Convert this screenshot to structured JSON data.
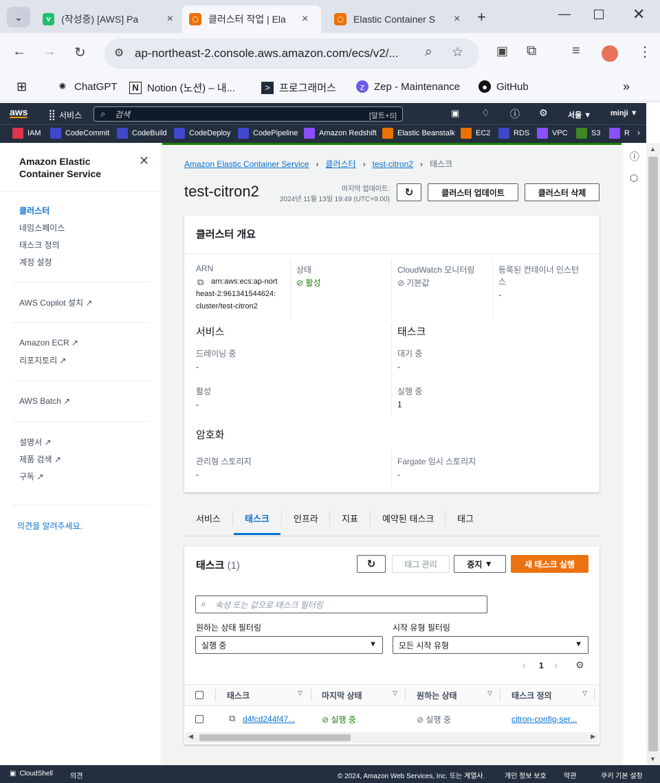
{
  "browser": {
    "tabs": [
      {
        "title": "(작성중) [AWS] Pa",
        "icon": "v-icon"
      },
      {
        "title": "클러스터 작업 | Ela",
        "icon": "ecs-icon"
      },
      {
        "title": "Elastic Container S",
        "icon": "ecs-icon"
      }
    ],
    "url": "ap-northeast-2.console.aws.amazon.com/ecs/v2/...",
    "bookmarks": [
      "ChatGPT",
      "Notion (노션) – 내...",
      "프로그래머스",
      "Zep - Maintenance",
      "GitHub"
    ]
  },
  "aws": {
    "services_label": "서비스",
    "search_placeholder": "검색",
    "search_shortcut": "[알트+S]",
    "region": "서울 ▼",
    "user": "minji ▼",
    "favorites": [
      {
        "label": "IAM",
        "color": "#dd344c"
      },
      {
        "label": "CodeCommit",
        "color": "#3f48cc"
      },
      {
        "label": "CodeBuild",
        "color": "#3f48cc"
      },
      {
        "label": "CodeDeploy",
        "color": "#3f48cc"
      },
      {
        "label": "CodePipeline",
        "color": "#3f48cc"
      },
      {
        "label": "Amazon Redshift",
        "color": "#8c4fff"
      },
      {
        "label": "Elastic Beanstalk",
        "color": "#ed7100"
      },
      {
        "label": "EC2",
        "color": "#ed7100"
      },
      {
        "label": "RDS",
        "color": "#3f48cc"
      },
      {
        "label": "VPC",
        "color": "#8c4fff"
      },
      {
        "label": "S3",
        "color": "#3f8624"
      },
      {
        "label": "R",
        "color": "#8c4fff"
      }
    ]
  },
  "sidebar": {
    "title": "Amazon Elastic Container Service",
    "items": [
      "클러스터",
      "네임스페이스",
      "태스크 정의",
      "계정 설정"
    ],
    "copilot": "AWS Copilot 설치",
    "ecr": "Amazon ECR",
    "repo": "리포지토리",
    "batch": "AWS Batch",
    "docs": "설명서",
    "search": "제품 검색",
    "subscribe": "구독",
    "feedback": "의견을 알려주세요."
  },
  "breadcrumb": [
    "Amazon Elastic Container Service",
    "클러스터",
    "test-citron2",
    "태스크"
  ],
  "cluster": {
    "name": "test-citron2",
    "last_updated_label": "마지막 업데이트:",
    "last_updated": "2024년 11월 13일 19:49 (UTC+9:00)",
    "update_btn": "클러스터 업데이트",
    "delete_btn": "클러스터 삭제"
  },
  "overview": {
    "title": "클러스터 개요",
    "arn_label": "ARN",
    "arn_lines": [
      "arn:aws:ecs:ap-nort",
      "heast-2:961341544624:",
      "cluster/test-citron2"
    ],
    "status_label": "상태",
    "status_value": "활성",
    "cw_label": "CloudWatch 모니터링",
    "cw_value": "기본값",
    "registered_label_1": "등록된 컨테이너 인스턴",
    "registered_label_2": "스",
    "registered_value": "-",
    "services_h": "서비스",
    "draining_label": "드레이닝 중",
    "draining_value": "-",
    "active_label": "활성",
    "active_value": "-",
    "tasks_h": "태스크",
    "pending_label": "대기 중",
    "pending_value": "-",
    "running_label": "실행 중",
    "running_value": "1",
    "encryption_h": "암호화",
    "managed_label": "관리형 스토리지",
    "managed_value": "-",
    "fargate_label": "Fargate 임시 스토리지",
    "fargate_value": "-"
  },
  "tabs": [
    "서비스",
    "태스크",
    "인프라",
    "지표",
    "예약된 태스크",
    "태그"
  ],
  "tasks": {
    "title": "태스크",
    "count": "(1)",
    "manage_tags": "태그 관리",
    "stop": "중지",
    "run_new": "새 태스크 실행",
    "filter_placeholder": "속성 또는 값으로 태스크 필터링",
    "desired_filter_label": "원하는 상태 필터링",
    "desired_filter_value": "실행 중",
    "launch_filter_label": "시작 유형 필터링",
    "launch_filter_value": "모든 시작 유형",
    "page": "1",
    "columns": [
      "태스크",
      "마지막 상태",
      "원하는 상태",
      "태스크 정의"
    ],
    "rows": [
      {
        "task": "d4fcd244f47...",
        "last_status": "실행 중",
        "desired": "실행 중",
        "definition": "citron-config-ser..."
      }
    ]
  },
  "footer": {
    "cloudshell": "CloudShell",
    "feedback": "의견",
    "copyright": "© 2024, Amazon Web Services, Inc. 또는 계열사.",
    "privacy": "개인 정보 보호",
    "terms": "약관",
    "cookies": "쿠키 기본 설정"
  }
}
